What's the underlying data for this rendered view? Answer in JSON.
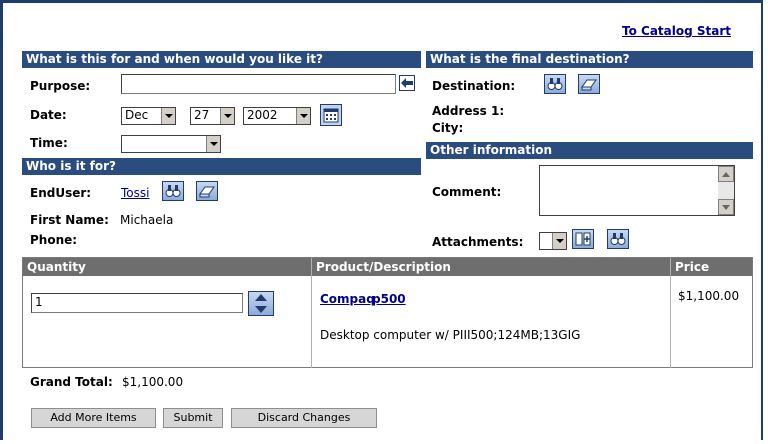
{
  "header": {
    "catalog_link": "To Catalog Start"
  },
  "when_section": {
    "title": "What is this for and when would you like it?",
    "purpose_label": "Purpose:",
    "purpose_value": "",
    "date_label": "Date:",
    "month": "Dec",
    "day": "27",
    "year": "2002",
    "time_label": "Time:",
    "time_value": ""
  },
  "destination_section": {
    "title": "What is the final destination?",
    "destination_label": "Destination:",
    "address_label": "Address 1:",
    "city_label": "City:"
  },
  "who_section": {
    "title": "Who is it for?",
    "enduser_label": "EndUser:",
    "enduser_value": "Tossi",
    "first_name_label": "First Name:",
    "first_name_value": "Michaela",
    "phone_label": "Phone:"
  },
  "other_section": {
    "title": "Other information",
    "comment_label": "Comment:",
    "attachments_label": "Attachments:"
  },
  "items_table": {
    "headers": {
      "quantity": "Quantity",
      "product": "Product/Description",
      "price": "Price"
    },
    "rows": [
      {
        "quantity": "1",
        "vendor": "Compaq",
        "model": "p500",
        "description": "Desktop computer w/ PIII500;124MB;13GIG",
        "price": "$1,100.00"
      }
    ]
  },
  "totals": {
    "grand_total_label": "Grand Total:",
    "grand_total_value": "$1,100.00"
  },
  "buttons": {
    "add_more": "Add More Items",
    "submit": "Submit",
    "discard": "Discard Changes"
  },
  "colors": {
    "section_header": "#2b4c7e",
    "table_header": "#6e6e6e",
    "frame": "#1e3c6e",
    "link": "#00008b"
  }
}
